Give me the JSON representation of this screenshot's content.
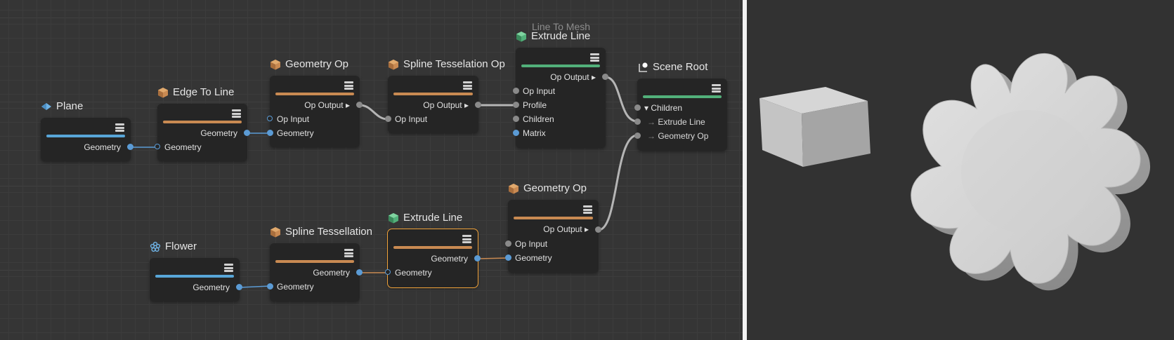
{
  "graph": {
    "nodes": {
      "plane": {
        "title": "Plane",
        "icon": "plane-icon",
        "ports": {
          "geometry_out": "Geometry"
        }
      },
      "edge_to_line": {
        "title": "Edge To Line",
        "icon": "operator-cube-icon",
        "ports": {
          "geometry_out": "Geometry",
          "geometry_in": "Geometry"
        }
      },
      "geometry_op_1": {
        "title": "Geometry Op",
        "icon": "operator-cube-icon",
        "ports": {
          "op_output": "Op Output",
          "op_input": "Op Input",
          "geometry_in": "Geometry"
        }
      },
      "spline_tess_op": {
        "title": "Spline Tesselation Op",
        "icon": "operator-cube-icon",
        "ports": {
          "op_output": "Op Output",
          "op_input": "Op Input"
        }
      },
      "extrude_line_1": {
        "supertitle": "Line To Mesh",
        "title": "Extrude Line",
        "icon": "mesh-cube-icon",
        "ports": {
          "op_output": "Op Output",
          "op_input": "Op Input",
          "profile": "Profile",
          "children": "Children",
          "matrix": "Matrix"
        }
      },
      "scene_root": {
        "title": "Scene Root",
        "icon": "scene-root-icon",
        "ports": {
          "children": "Children",
          "extrude_line": "Extrude Line",
          "geometry_op": "Geometry Op"
        }
      },
      "flower": {
        "title": "Flower",
        "icon": "flower-icon",
        "ports": {
          "geometry_out": "Geometry"
        }
      },
      "spline_tess": {
        "title": "Spline Tessellation",
        "icon": "operator-cube-icon",
        "ports": {
          "geometry_out": "Geometry",
          "geometry_in": "Geometry"
        }
      },
      "extrude_line_2": {
        "title": "Extrude Line",
        "icon": "mesh-cube-icon",
        "ports": {
          "geometry_out": "Geometry",
          "geometry_in": "Geometry"
        }
      },
      "geometry_op_2": {
        "title": "Geometry Op",
        "icon": "operator-cube-icon",
        "ports": {
          "op_output": "Op Output",
          "op_input": "Op Input",
          "geometry_in": "Geometry"
        }
      }
    },
    "colors": {
      "geometry_bar": "#58a6d8",
      "operator_bar": "#c98a52",
      "mesh_bar": "#52b07a",
      "port_blue": "#5b9bd5",
      "port_gray": "#8a8a8a",
      "wire_blue": "#5b9bd5",
      "wire_gray": "#b5b5b5",
      "selected_outline": "#f0a23a"
    }
  },
  "viewport": {
    "objects": [
      "box-mesh",
      "flower-extrusion-mesh"
    ]
  }
}
